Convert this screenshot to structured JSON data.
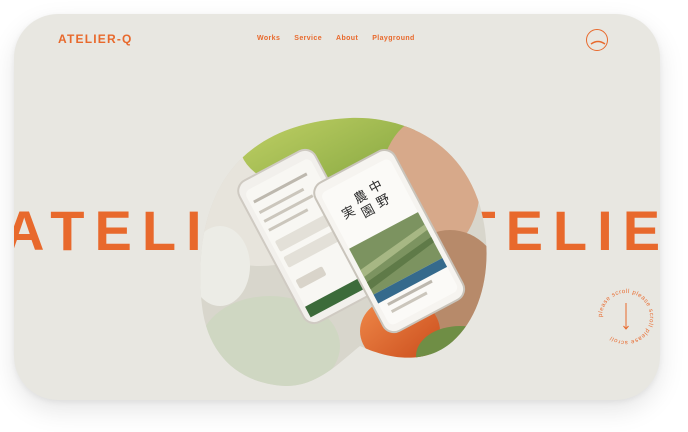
{
  "brand": {
    "logo": "ATELIER-Q",
    "accent_color": "#e8692c",
    "background": "#e8e7e1"
  },
  "nav": {
    "items": [
      "Works",
      "Service",
      "About",
      "Playground"
    ]
  },
  "menu": {
    "icon": "circle-menu-icon"
  },
  "hero": {
    "marquee_text": "ATELIER-Q  ATELIER-Q  ATELIER-Q",
    "phone_front": {
      "title_chars": [
        "中",
        "野",
        "農",
        "園",
        "実"
      ]
    }
  },
  "scroll": {
    "text": "please scroll please scroll please scroll "
  }
}
